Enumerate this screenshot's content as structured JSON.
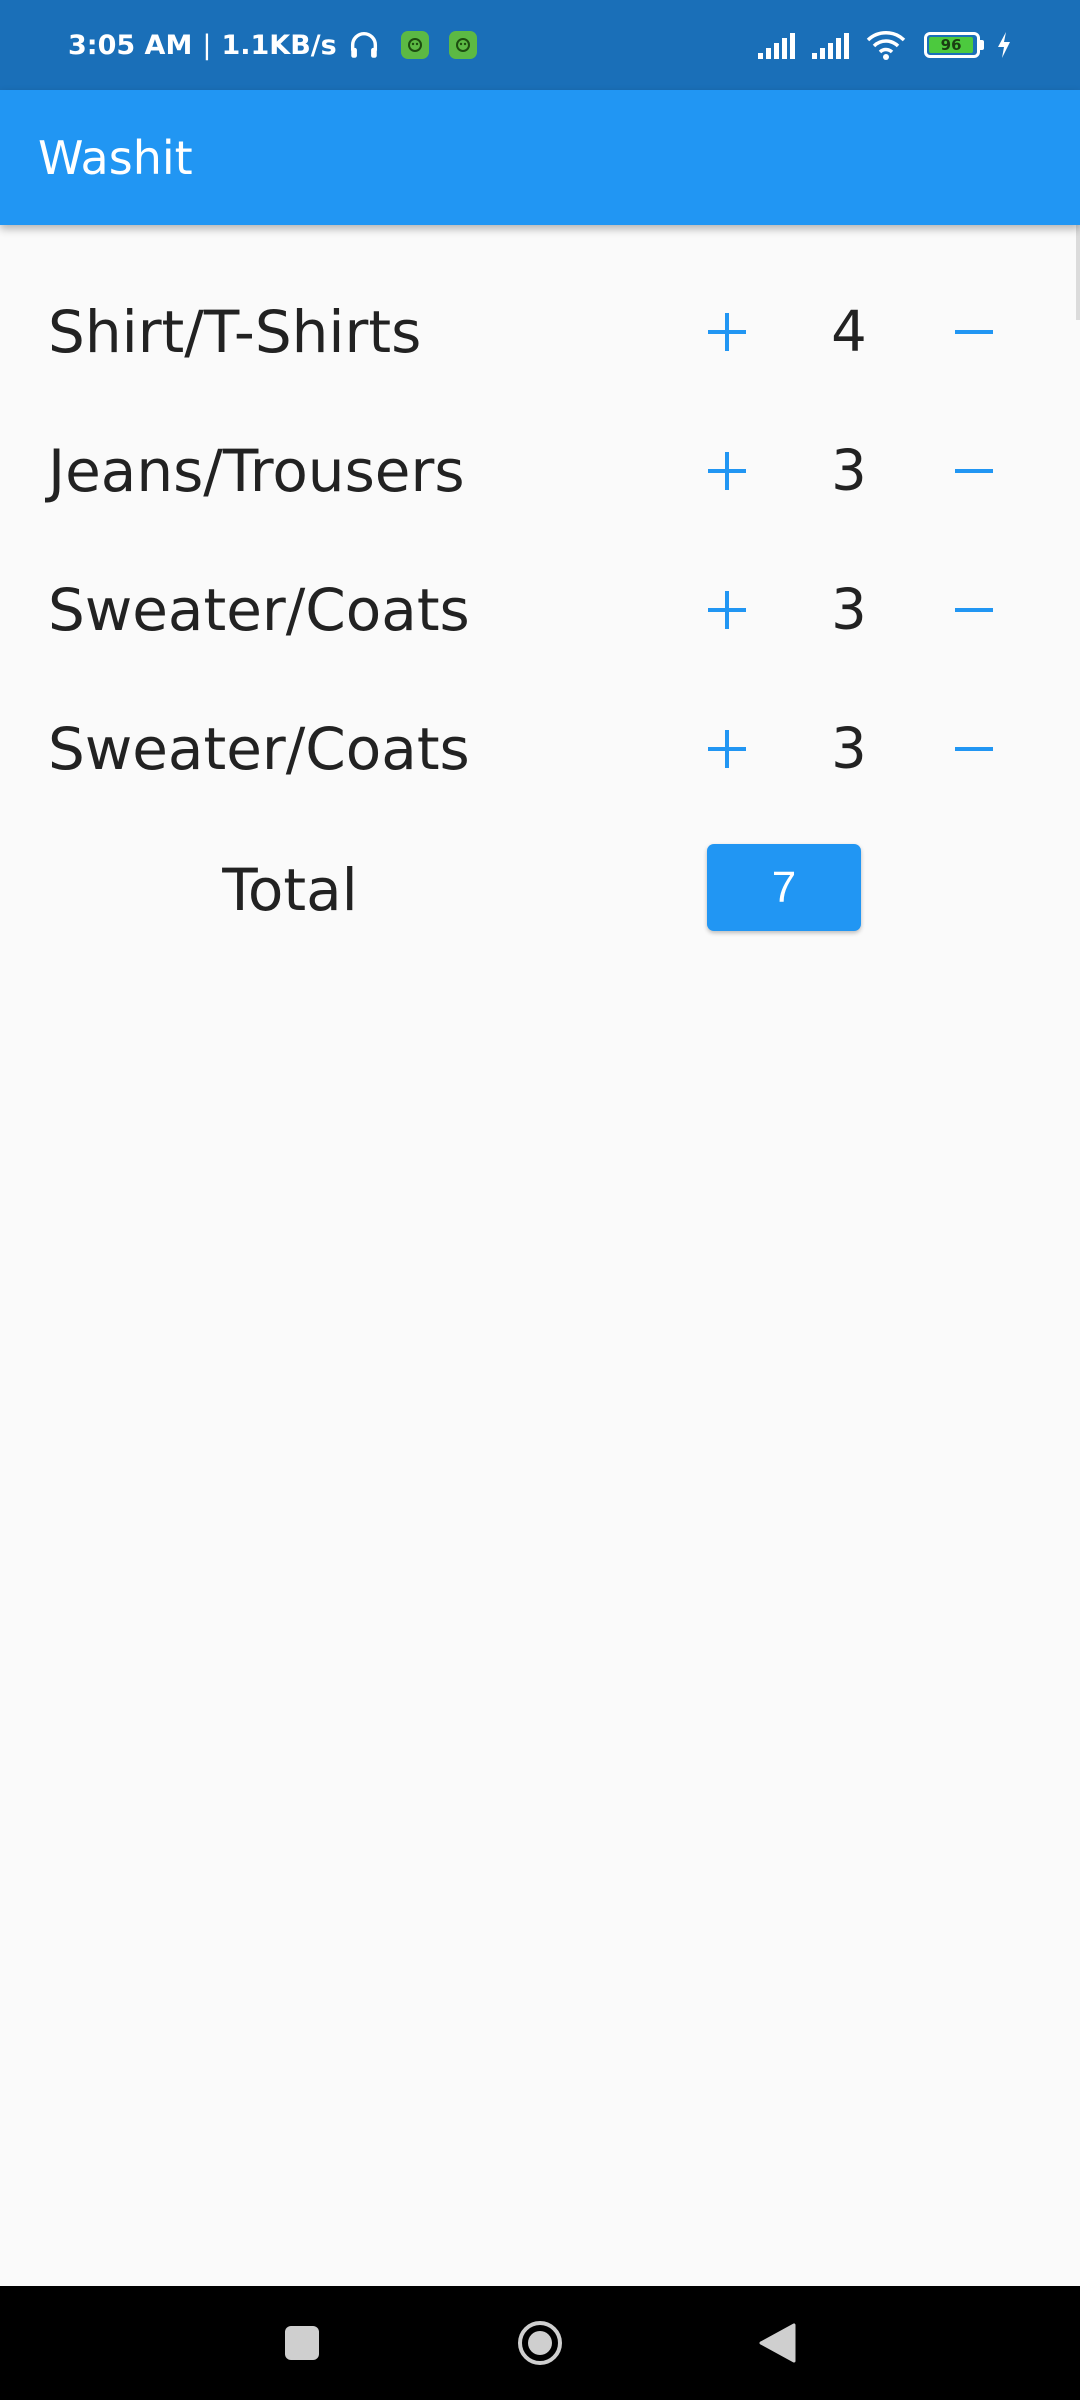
{
  "status_bar": {
    "time": "3:05 AM",
    "separator": "|",
    "net_speed": "1.1KB/s",
    "battery_level": "96",
    "icons": [
      "headphones-icon",
      "app-notification-icon",
      "app-notification-icon",
      "signal-icon",
      "signal-icon",
      "wifi-icon",
      "battery-icon",
      "charging-icon"
    ]
  },
  "app_bar": {
    "title": "Washit"
  },
  "items": [
    {
      "label": "Shirt/T-Shirts",
      "quantity": "4",
      "plus": "+",
      "minus": "−"
    },
    {
      "label": "Jeans/Trousers",
      "quantity": "3",
      "plus": "+",
      "minus": "−"
    },
    {
      "label": "Sweater/Coats",
      "quantity": "3",
      "plus": "+",
      "minus": "−"
    },
    {
      "label": "Sweater/Coats",
      "quantity": "3",
      "plus": "+",
      "minus": "−"
    }
  ],
  "total": {
    "label": "Total",
    "value": "7"
  },
  "nav": [
    "recents-icon",
    "home-icon",
    "back-icon"
  ],
  "colors": {
    "primary": "#2196f3",
    "status_bar": "#1a6fb8",
    "background": "#fafafa",
    "text": "#222222"
  }
}
